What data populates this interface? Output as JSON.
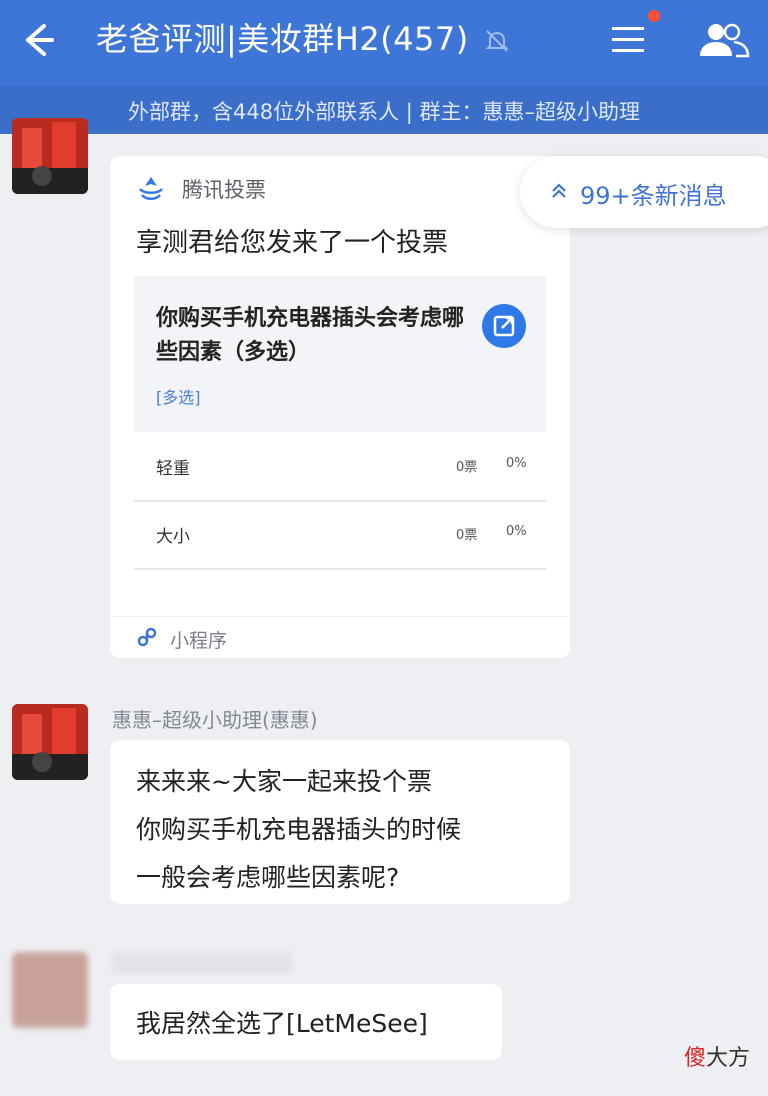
{
  "header": {
    "title": "老爸评测|美妆群H2(457)",
    "subtitle": "外部群，含448位外部联系人 | 群主：惠惠–超级小助理"
  },
  "new_messages": {
    "label": "99+条新消息"
  },
  "card": {
    "brand": "腾讯投票",
    "description": "享测君给您发来了一个投票",
    "question": "你购买手机充电器插头会考虑哪些因素（多选）",
    "tag": "[多选]",
    "options": [
      {
        "label": "轻重",
        "votes": "0票",
        "percent": "0%"
      },
      {
        "label": "大小",
        "votes": "0票",
        "percent": "0%"
      }
    ],
    "footer": "小程序"
  },
  "messages": [
    {
      "sender": "惠惠–超级小助理(惠惠)",
      "lines": [
        "来来来~大家一起来投个票",
        "你购买手机充电器插头的时候",
        "一般会考虑哪些因素呢?"
      ]
    },
    {
      "sender": "",
      "text": "我居然全选了[LetMeSee]"
    }
  ],
  "watermark": {
    "red": "傻",
    "rest": "大方"
  }
}
